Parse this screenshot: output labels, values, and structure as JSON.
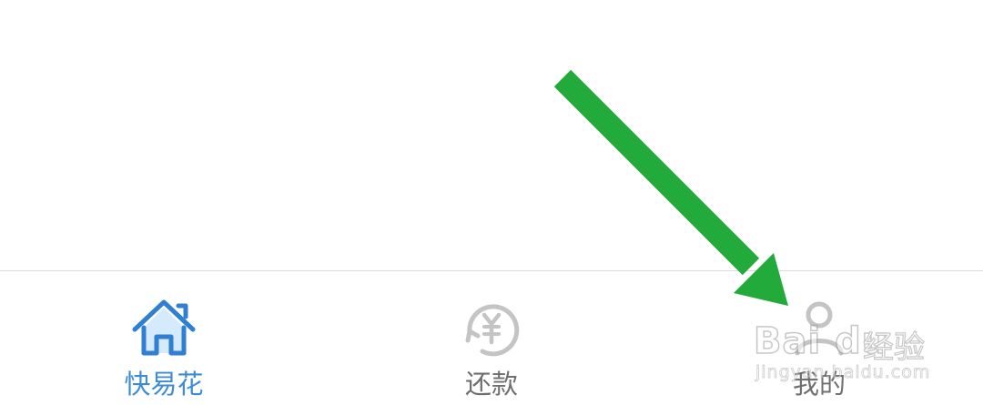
{
  "tabbar": {
    "tabs": [
      {
        "label": "快易花",
        "icon": "home-icon",
        "active": true
      },
      {
        "label": "还款",
        "icon": "yuan-repay-icon",
        "active": false
      },
      {
        "label": "我的",
        "icon": "user-icon",
        "active": false
      }
    ]
  },
  "annotation": {
    "arrow_color": "#22aa3a",
    "arrow_target": "tab-mine"
  },
  "watermark": {
    "logo": "Bai du",
    "brand": "经验",
    "url": "jingyan.baidu.com"
  },
  "colors": {
    "active": "#3e8bd6",
    "inactive": "#6f6f6f",
    "icon_inactive": "#c4c4c4",
    "divider": "#dcdcdc"
  }
}
